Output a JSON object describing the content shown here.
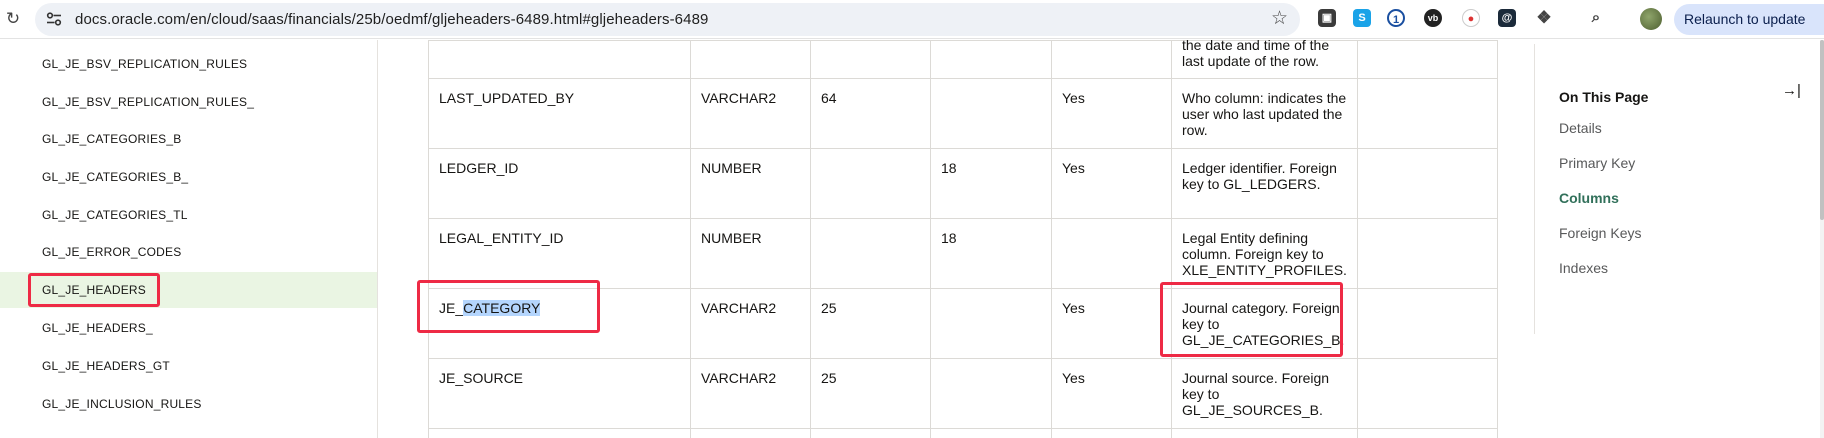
{
  "browser": {
    "url": "docs.oracle.com/en/cloud/saas/financials/25b/oedmf/gljeheaders-6489.html#gljeheaders-6489",
    "relaunch_label": "Relaunch to update"
  },
  "leftnav": {
    "items": [
      {
        "label": "GL_JE_BSV_REPLICATION_RULES"
      },
      {
        "label": "GL_JE_BSV_REPLICATION_RULES_"
      },
      {
        "label": "GL_JE_CATEGORIES_B"
      },
      {
        "label": "GL_JE_CATEGORIES_B_"
      },
      {
        "label": "GL_JE_CATEGORIES_TL"
      },
      {
        "label": "GL_JE_ERROR_CODES"
      },
      {
        "label": "GL_JE_HEADERS"
      },
      {
        "label": "GL_JE_HEADERS_"
      },
      {
        "label": "GL_JE_HEADERS_GT"
      },
      {
        "label": "GL_JE_INCLUSION_RULES"
      }
    ],
    "active_label": "GL_JE_HEADERS"
  },
  "table": {
    "top_partial": {
      "desc_line1": "the date and time of the",
      "desc_line2": "last update of the row."
    },
    "rows": [
      {
        "name": "LAST_UPDATED_BY",
        "datatype": "VARCHAR2",
        "length": "64",
        "precision": "",
        "not_null": "Yes",
        "desc": "Who column: indicates the user who last updated the row."
      },
      {
        "name": "LEDGER_ID",
        "datatype": "NUMBER",
        "length": "",
        "precision": "18",
        "not_null": "Yes",
        "desc": "Ledger identifier. Foreign key to GL_LEDGERS."
      },
      {
        "name": "LEGAL_ENTITY_ID",
        "datatype": "NUMBER",
        "length": "",
        "precision": "18",
        "not_null": "",
        "desc": "Legal Entity defining column. Foreign key to XLE_ENTITY_PROFILES."
      },
      {
        "name_prefix": "JE_",
        "name_selected": "CATEGORY",
        "datatype": "VARCHAR2",
        "length": "25",
        "precision": "",
        "not_null": "Yes",
        "desc": "Journal category. Foreign key to GL_JE_CATEGORIES_B."
      },
      {
        "name": "JE_SOURCE",
        "datatype": "VARCHAR2",
        "length": "25",
        "precision": "",
        "not_null": "Yes",
        "desc": "Journal source. Foreign key to GL_JE_SOURCES_B."
      }
    ]
  },
  "on_this_page": {
    "title": "On This Page",
    "items": [
      {
        "label": "Details"
      },
      {
        "label": "Primary Key"
      },
      {
        "label": "Columns"
      },
      {
        "label": "Foreign Keys"
      },
      {
        "label": "Indexes"
      }
    ],
    "current": "Columns"
  },
  "colors": {
    "highlight_box": "#ee2a45",
    "active_nav_bg": "#eaf5e3",
    "current_link": "#31705a",
    "text_selection": "#b4d5fd"
  }
}
